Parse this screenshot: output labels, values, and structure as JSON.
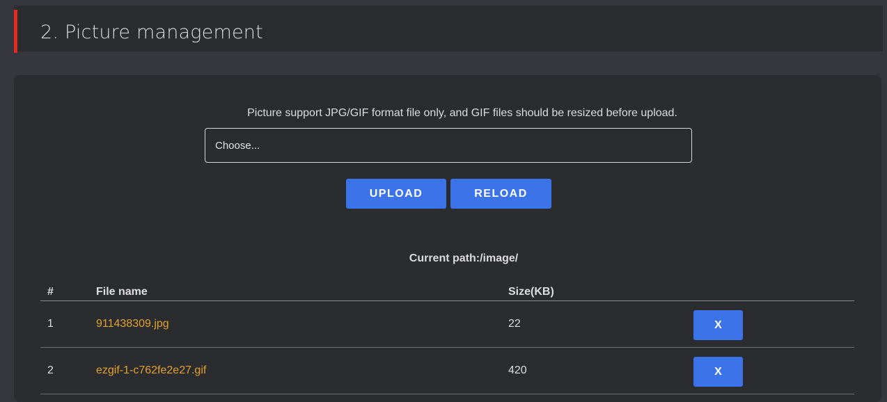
{
  "section": {
    "title": "2. Picture management",
    "accent_color": "#e52820"
  },
  "upload": {
    "info": "Picture support JPG/GIF format file only,  and GIF files should be resized before upload.",
    "file_input_value": "Choose...",
    "upload_label": "UPLOAD",
    "reload_label": "RELOAD",
    "button_color": "#3b74e8"
  },
  "current_path": "Current path:/image/",
  "table": {
    "headers": {
      "index": "#",
      "file_name": "File name",
      "size": "Size(KB)"
    },
    "rows": [
      {
        "index": "1",
        "file_name": "911438309.jpg",
        "size": "22",
        "delete_label": "X"
      },
      {
        "index": "2",
        "file_name": "ezgif-1-c762fe2e27.gif",
        "size": "420",
        "delete_label": "X"
      }
    ],
    "link_color": "#e3a22a"
  }
}
